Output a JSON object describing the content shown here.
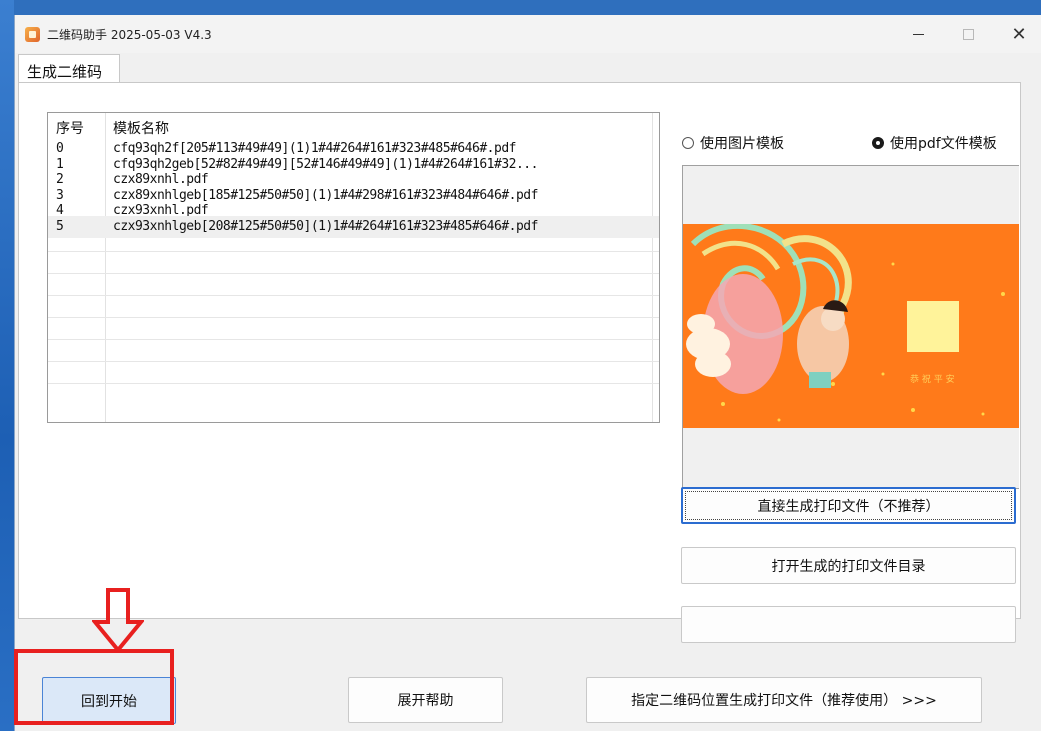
{
  "window": {
    "title": "二维码助手 2025-05-03 V4.3",
    "controls": {
      "minimize": "—",
      "maximize": "",
      "close": "✕"
    }
  },
  "tab": {
    "label": "生成二维码"
  },
  "table": {
    "columns": [
      "序号",
      "模板名称"
    ],
    "rows": [
      [
        "0",
        "cfq93qh2f[205#113#49#49](1)1#4#264#161#323#485#646#.pdf"
      ],
      [
        "1",
        "cfq93qh2geb[52#82#49#49][52#146#49#49](1)1#4#264#161#32..."
      ],
      [
        "2",
        "czx89xnhl.pdf"
      ],
      [
        "3",
        "czx89xnhlgeb[185#125#50#50](1)1#4#298#161#323#484#646#.pdf"
      ],
      [
        "4",
        "czx93xnhl.pdf"
      ],
      [
        "5",
        "czx93xnhlgeb[208#125#50#50](1)1#4#264#161#323#485#646#.pdf"
      ]
    ],
    "selected_row": 5
  },
  "template_mode": {
    "image_label": "使用图片模板",
    "pdf_label": "使用pdf文件模板",
    "selected": "pdf"
  },
  "preview": {
    "stamp_text": "恭 祝 平 安"
  },
  "buttons": {
    "generate_direct": "直接生成打印文件（不推荐）",
    "open_dir": "打开生成的打印文件目录",
    "back": "回到开始",
    "help": "展开帮助",
    "specify": "指定二维码位置生成打印文件（推荐使用） >>>"
  },
  "colors": {
    "annotation": "#e8201f",
    "accent": "#2b6cd0",
    "preview_bg": "#ff7a1a"
  }
}
